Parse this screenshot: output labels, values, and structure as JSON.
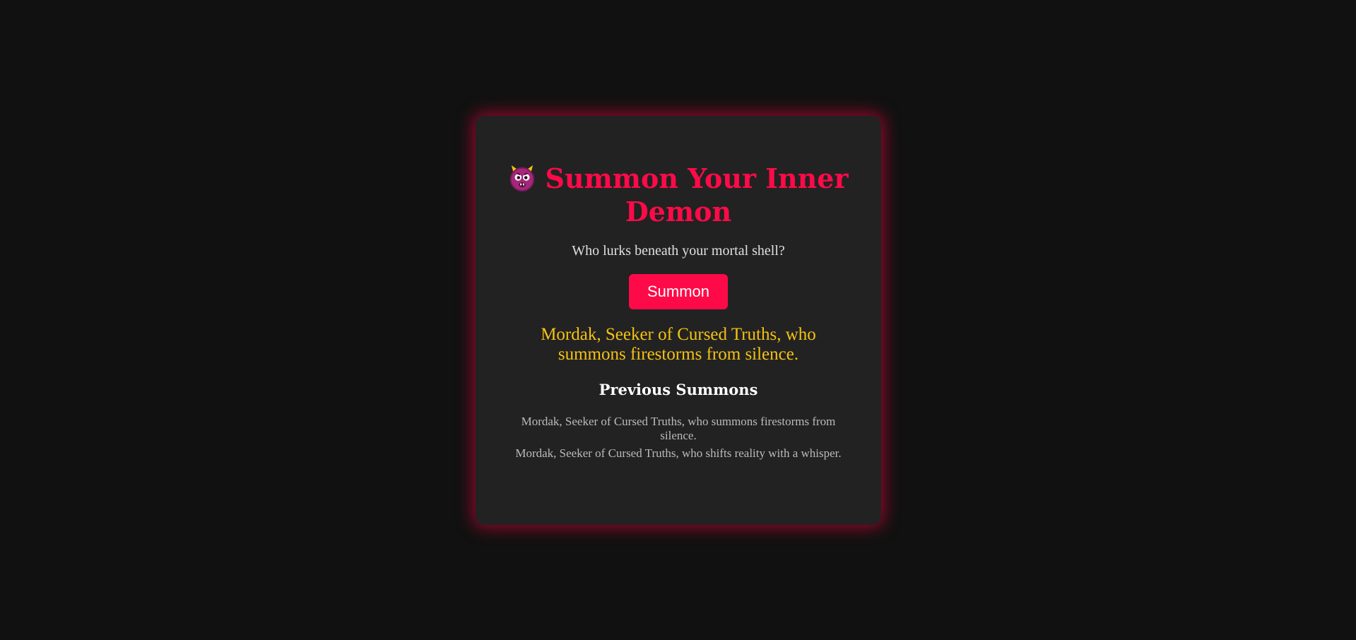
{
  "app": {
    "title": "Summon Your Inner Demon",
    "icon": "demon-face-icon",
    "subtitle": "Who lurks beneath your mortal shell?",
    "summon_label": "Summon",
    "current_result": "Mordak, Seeker of Cursed Truths, who summons firestorms from silence.",
    "history_heading": "Previous Summons",
    "history": [
      "Mordak, Seeker of Cursed Truths, who summons firestorms from silence.",
      "Mordak, Seeker of Cursed Truths, who shifts reality with a whisper."
    ]
  },
  "colors": {
    "background": "#111111",
    "card": "#222222",
    "accent": "#ff0a48",
    "result": "#f5c211",
    "glow": "#ff0040"
  }
}
